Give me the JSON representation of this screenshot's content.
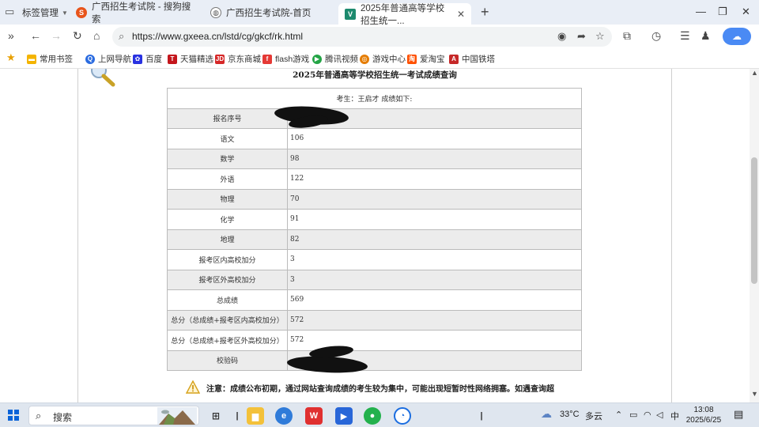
{
  "browser": {
    "tab_groups_label": "标签管理",
    "tabs": [
      {
        "title": "广西招生考试院 - 搜狗搜索"
      },
      {
        "title": "广西招生考试院-首页"
      },
      {
        "title": "2025年普通高等学校招生统一..."
      }
    ],
    "url": "https://www.gxeea.cn/lstd/cg/gkcf/rk.html",
    "bookmarks": [
      "常用书签",
      "上网导航",
      "百度",
      "天猫精选",
      "京东商城",
      "flash游戏",
      "腾讯视频",
      "游戏中心",
      "爱淘宝",
      "中国铁塔"
    ]
  },
  "page": {
    "title": "2025年普通高等学校招生统一考试成绩查询",
    "candidate_line": "考生：王启才 成绩如下:",
    "rows": [
      {
        "label": "报名序号",
        "value": ""
      },
      {
        "label": "语文",
        "value": "106"
      },
      {
        "label": "数学",
        "value": "98"
      },
      {
        "label": "外语",
        "value": "122"
      },
      {
        "label": "物理",
        "value": "70"
      },
      {
        "label": "化学",
        "value": "91"
      },
      {
        "label": "地理",
        "value": "82"
      },
      {
        "label": "报考区内高校加分",
        "value": "3"
      },
      {
        "label": "报考区外高校加分",
        "value": "3"
      },
      {
        "label": "总成绩",
        "value": "569"
      },
      {
        "label": "总分（总成绩+报考区内高校加分）",
        "value": "572"
      },
      {
        "label": "总分（总成绩+报考区外高校加分）",
        "value": "572"
      },
      {
        "label": "校验码",
        "value": ""
      }
    ],
    "notice": "注意：成绩公布初期，通过网站查询成绩的考生较为集中，可能出现短暂时性网络拥塞。如遇查询超"
  },
  "taskbar": {
    "search_placeholder": "搜索",
    "weather_temp": "33°C",
    "weather_desc": "多云",
    "ime": "中",
    "time": "13:08",
    "date": "2025/6/25"
  },
  "colors": {
    "accent_blue": "#4a8af4",
    "table_shade": "#ececec",
    "tabbar_bg": "#e9eef6"
  }
}
